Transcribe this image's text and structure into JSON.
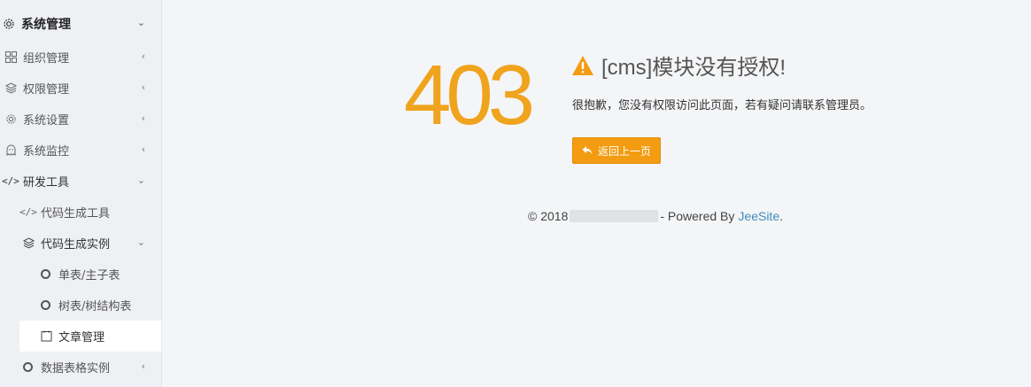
{
  "sidebar": {
    "items": [
      {
        "label": "系统管理",
        "icon": "gear-icon",
        "arrow": "⌄"
      },
      {
        "label": "组织管理",
        "icon": "grid-icon",
        "arrow": "‹"
      },
      {
        "label": "权限管理",
        "icon": "cube-icon",
        "arrow": "‹"
      },
      {
        "label": "系统设置",
        "icon": "gear-icon",
        "arrow": "‹"
      },
      {
        "label": "系统监控",
        "icon": "ghost-icon",
        "arrow": "‹"
      },
      {
        "label": "研发工具",
        "icon": "code-icon",
        "arrow": "⌄"
      },
      {
        "label": "代码生成工具",
        "icon": "code-icon"
      },
      {
        "label": "代码生成实例",
        "icon": "cube-icon",
        "arrow": "⌄"
      },
      {
        "label": "单表/主子表",
        "icon": "circle-icon"
      },
      {
        "label": "树表/树结构表",
        "icon": "circle-icon"
      },
      {
        "label": "文章管理",
        "icon": "document-icon"
      },
      {
        "label": "数据表格实例",
        "icon": "circle-icon",
        "arrow": "‹"
      }
    ]
  },
  "error": {
    "code": "403",
    "title": "[cms]模块没有授权!",
    "description": "很抱歉，您没有权限访问此页面，若有疑问请联系管理员。",
    "back_label": "返回上一页"
  },
  "footer": {
    "copyright": "© 2018",
    "powered_by": "- Powered By",
    "brand": "JeeSite",
    "period": "."
  },
  "colors": {
    "accent": "#f39c12",
    "code": "#f0a31d",
    "link": "#3c8dbc"
  }
}
